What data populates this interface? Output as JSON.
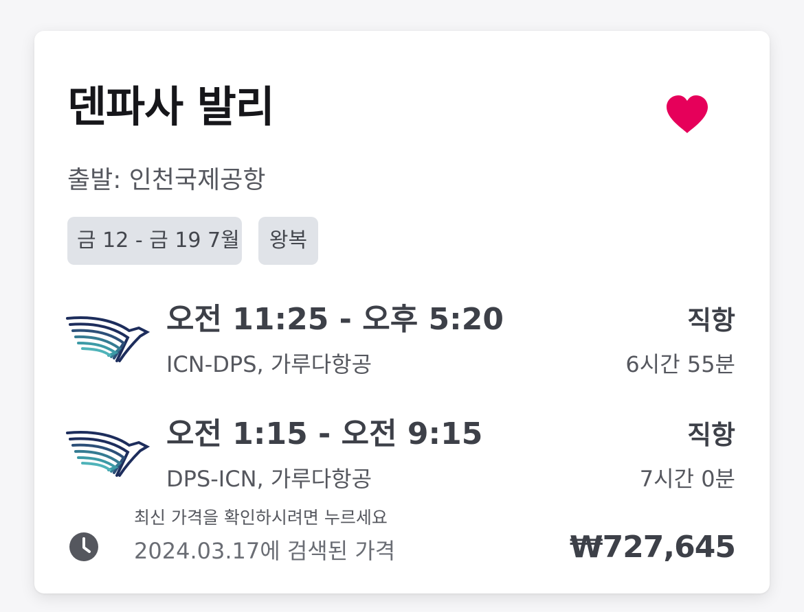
{
  "card": {
    "title": "덴파사 발리",
    "origin": "출발: 인천국제공항",
    "favorite_color": "#e6005a",
    "chips": {
      "dates": "금 12 - 금 19 7월",
      "trip_type": "왕복"
    },
    "legs": [
      {
        "times": "오전 11:25 - 오후 5:20",
        "route": "ICN-DPS, 가루다항공",
        "stops": "직항",
        "duration": "6시간 55분",
        "airline_logo": "garuda-bird-logo"
      },
      {
        "times": "오전 1:15 - 오전 9:15",
        "route": "DPS-ICN, 가루다항공",
        "stops": "직항",
        "duration": "7시간 0분",
        "airline_logo": "garuda-bird-logo"
      }
    ],
    "refresh_hint": "최신 가격을 확인하시려면 누르세요",
    "searched_at": "2024.03.17에 검색된 가격",
    "price": "₩727,645"
  },
  "icons": {
    "favorite": "heart-icon",
    "clock": "clock-icon"
  },
  "colors": {
    "chip_bg": "#e0e3e8",
    "text_dark": "#3d4048",
    "garuda_navy": "#1d2d5c",
    "garuda_teal": "#3c9aa6"
  }
}
